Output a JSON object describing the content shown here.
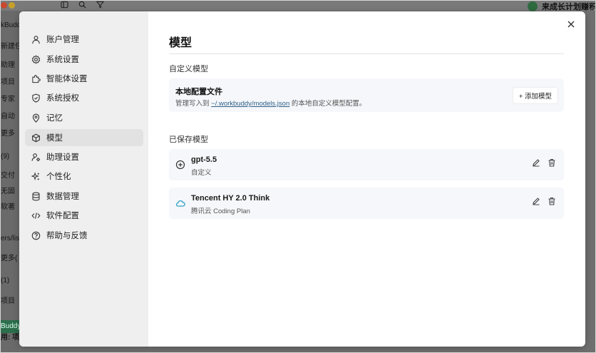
{
  "background": {
    "user_name": "来成长计划赚积",
    "sidebar_fragments": [
      "kBudd",
      "新建任",
      "助理",
      "项目",
      "专家",
      "自动",
      "更多",
      "(9)",
      "交付",
      "无固",
      "软著",
      "ers/lis",
      "更多(",
      "(1)",
      "项目",
      "Buddy",
      "用: 项"
    ]
  },
  "modal": {
    "nav": [
      {
        "label": "账户管理",
        "icon": "user-icon"
      },
      {
        "label": "系统设置",
        "icon": "gear-icon"
      },
      {
        "label": "智能体设置",
        "icon": "puzzle-icon"
      },
      {
        "label": "系统授权",
        "icon": "shield-icon"
      },
      {
        "label": "记忆",
        "icon": "location-pin-icon"
      },
      {
        "label": "模型",
        "icon": "cube-icon",
        "active": true
      },
      {
        "label": "助理设置",
        "icon": "user-gear-icon"
      },
      {
        "label": "个性化",
        "icon": "sparkle-icon"
      },
      {
        "label": "数据管理",
        "icon": "database-icon"
      },
      {
        "label": "软件配置",
        "icon": "code-icon"
      },
      {
        "label": "帮助与反馈",
        "icon": "help-circle-icon"
      }
    ],
    "title": "模型",
    "custom_section_label": "自定义模型",
    "local_config": {
      "title": "本地配置文件",
      "desc_prefix": "管理写入到 ",
      "desc_link": "~/.workbuddy/models.json",
      "desc_suffix": " 的本地自定义模型配置。",
      "add_button": "+ 添加模型"
    },
    "saved_section_label": "已保存模型",
    "saved_models": [
      {
        "name": "gpt-5.5",
        "sub": "自定义",
        "icon": "plus-circle-icon"
      },
      {
        "name": "Tencent HY 2.0 Think",
        "sub": "腾讯云 Coding Plan",
        "icon": "cloud-icon"
      }
    ]
  },
  "colors": {
    "accent_link": "#2f5f88",
    "sidebar_bg": "#efefef",
    "active_bg": "#e2e2e2",
    "card_bg": "#f5f7fa",
    "cloud_icon": "#2a9fc4"
  }
}
